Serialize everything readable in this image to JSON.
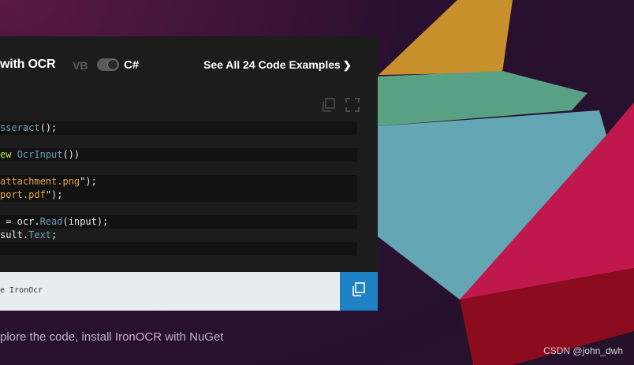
{
  "header": {
    "title": "with OCR",
    "lang_vb": "VB",
    "lang_cs": "C#",
    "see_all": "See All 24 Code Examples",
    "see_all_chevron": "❯"
  },
  "code_lines": [
    [
      "sseract",
      "();"
    ],
    [
      ""
    ],
    [
      "ew ",
      "OcrInput",
      "())"
    ],
    [
      ""
    ],
    [
      "attachment.png",
      "\");"
    ],
    [
      "port.pdf",
      "\");"
    ],
    [
      ""
    ],
    [
      " = ocr.",
      "Read",
      "(input);"
    ],
    [
      "sult.",
      "Text",
      ";"
    ],
    [
      ""
    ]
  ],
  "install": {
    "command": "e IronOcr"
  },
  "footer": {
    "prefix": "plore the code, install ",
    "link": "IronOCR",
    "suffix": " with NuGet"
  },
  "watermark": "CSDN @john_dwh",
  "icons": {
    "copy": "copy-icon",
    "expand": "expand-icon",
    "install_copy": "copy-icon"
  },
  "colors": {
    "accent": "#1f82c5",
    "panel": "#1c1c1c",
    "yellow_shape": "#c8902a",
    "green_shape": "#58a185",
    "teal_shape": "#65a6b4",
    "pink_shape": "#c0184c",
    "red_shape": "#8c0c1f"
  }
}
